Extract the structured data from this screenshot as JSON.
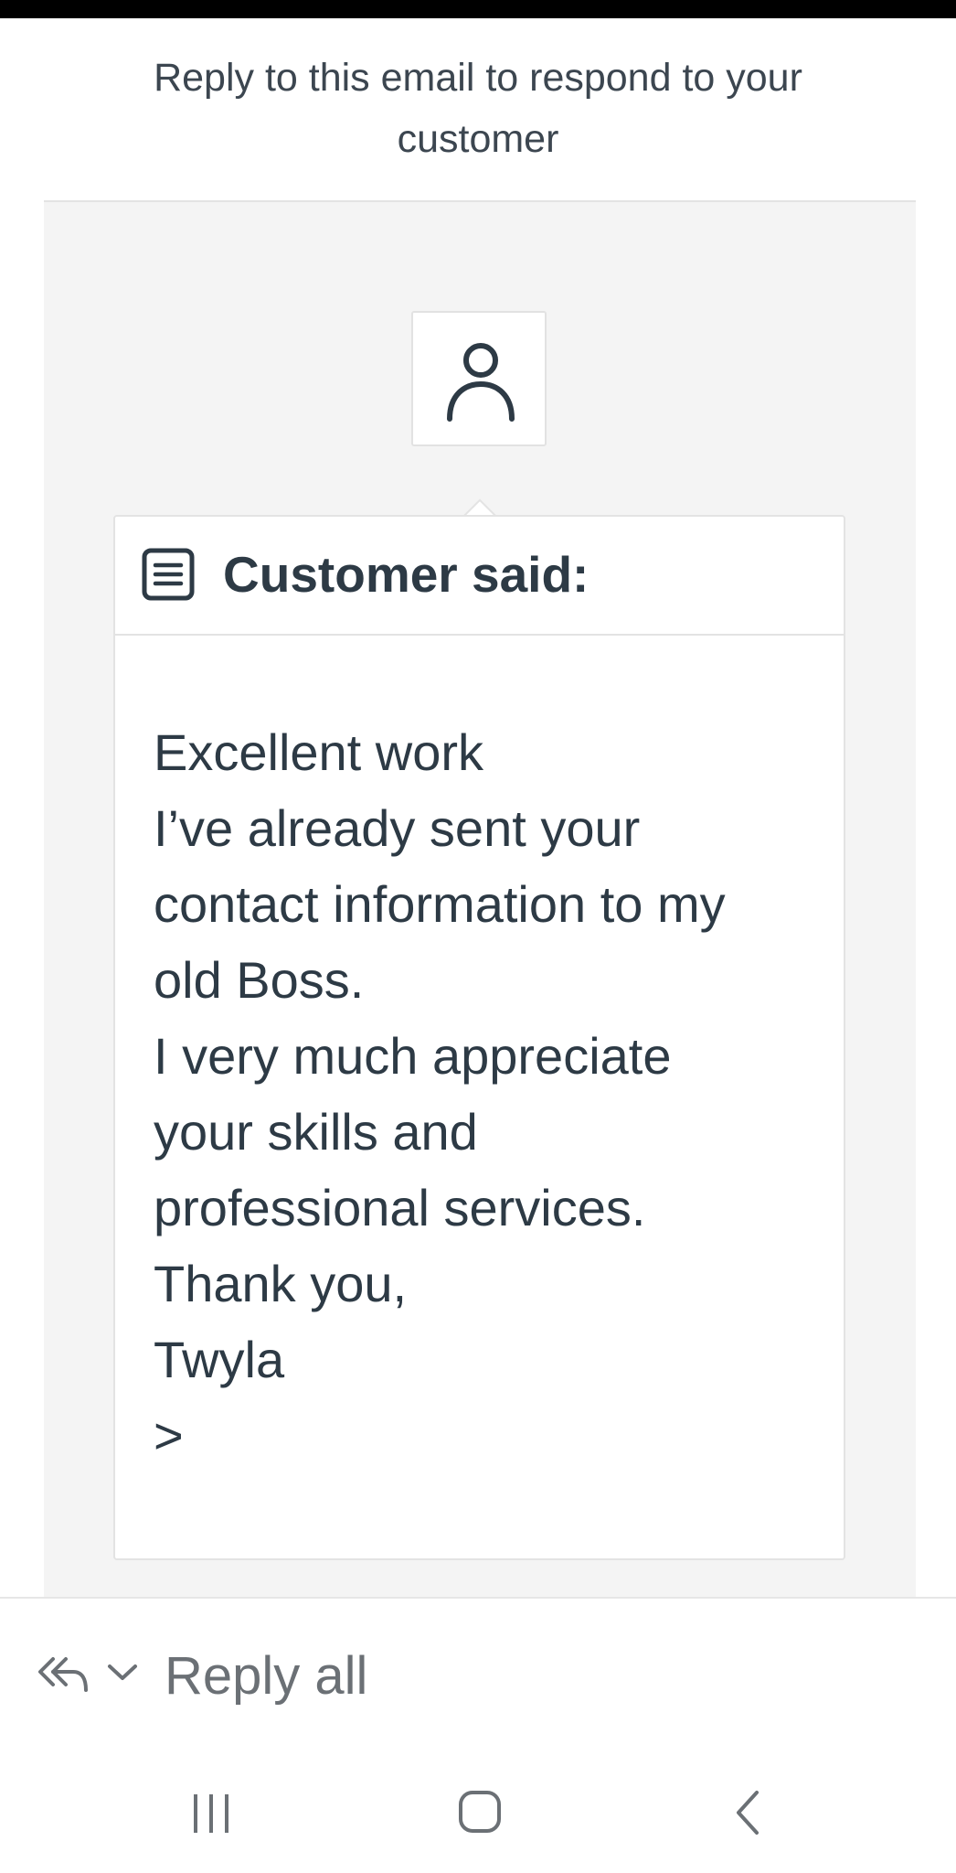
{
  "header": {
    "notice_line1": "Reply to this email to respond to your",
    "notice_line2": "customer"
  },
  "card": {
    "title": "Customer said:",
    "message_lines": [
      "Excellent work",
      "I’ve already sent your",
      "contact information to my",
      "old Boss.",
      "I very much appreciate",
      "your skills and",
      "professional services.",
      "Thank you,",
      "Twyla",
      ">"
    ]
  },
  "reply_bar": {
    "reply_all_label": "Reply all",
    "reply_icon": "reply-all-icon",
    "dropdown_icon": "chevron-down-icon"
  },
  "nav": {
    "recents_icon": "recent-apps-icon",
    "home_icon": "home-icon",
    "back_icon": "back-icon"
  },
  "colors": {
    "text": "#2d3a45",
    "panel_bg": "#f4f4f4",
    "border": "#e3e3e3",
    "muted": "#6b7075"
  }
}
